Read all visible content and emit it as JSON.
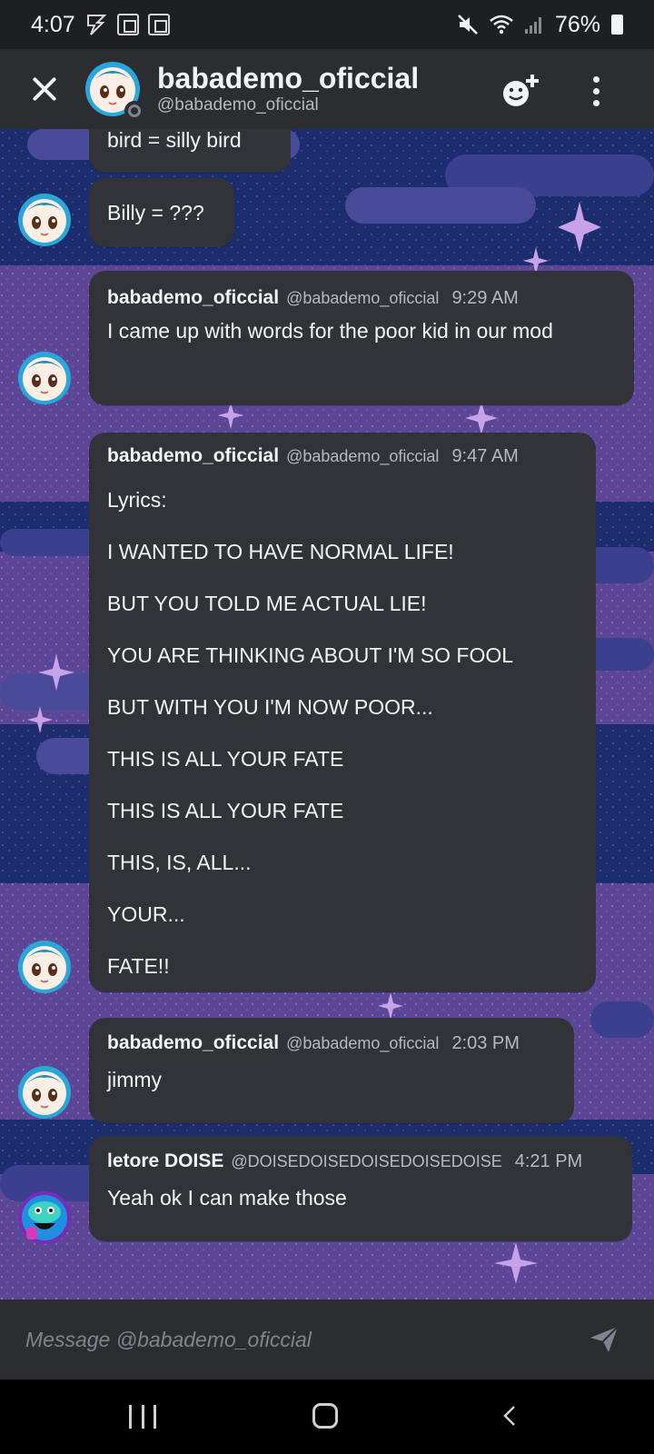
{
  "status_bar": {
    "time": "4:07",
    "battery": "76%"
  },
  "header": {
    "name": "babademo_oficcial",
    "handle": "@babademo_oficcial"
  },
  "messages": [
    {
      "text": "bird = silly bird"
    },
    {
      "text": "Billy = ???"
    },
    {
      "author": "babademo_oficcial",
      "handle": "@babademo_oficcial",
      "time": "9:29 AM",
      "text": "I came up with words for the poor kid in our mod"
    },
    {
      "author": "babademo_oficcial",
      "handle": "@babademo_oficcial",
      "time": "9:47 AM",
      "lines": [
        "Lyrics:",
        "I WANTED TO HAVE NORMAL LIFE!",
        "BUT YOU TOLD ME ACTUAL LIE!",
        "YOU ARE THINKING ABOUT I'M SO FOOL",
        "BUT WITH YOU I'M NOW POOR...",
        "THIS IS ALL YOUR FATE",
        "THIS IS ALL YOUR FATE",
        "THIS, IS, ALL...",
        "YOUR...",
        "FATE!!"
      ]
    },
    {
      "author": "babademo_oficcial",
      "handle": "@babademo_oficcial",
      "time": "2:03 PM",
      "text": "jimmy"
    },
    {
      "author": "letore DOISE",
      "handle": "@DOISEDOISEDOISEDOISEDOISE",
      "time": "4:21 PM",
      "text": "Yeah ok I can make those"
    }
  ],
  "composer": {
    "placeholder": "Message @babademo_oficcial"
  },
  "colors": {
    "background": "#1c2d6e",
    "bubble": "#313338",
    "header": "#2b2d31"
  },
  "icons": {
    "close": "close-icon",
    "add_friend": "add-friend-icon",
    "more": "more-vertical-icon",
    "send": "send-icon"
  }
}
